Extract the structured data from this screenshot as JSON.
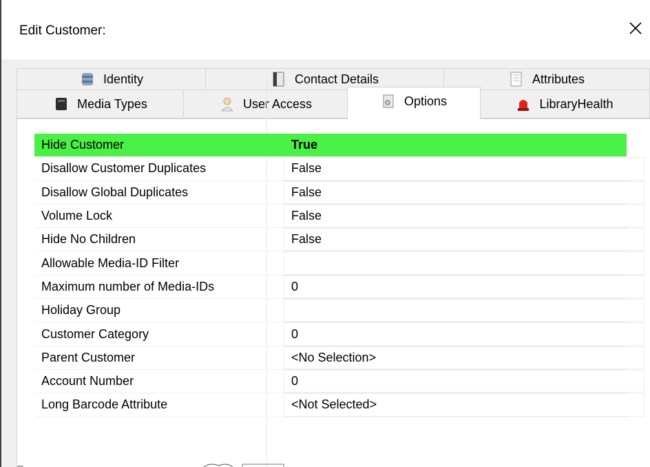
{
  "window": {
    "title": "Edit Customer:",
    "close_glyph": "✕"
  },
  "tabs_row1": [
    {
      "label": "Identity",
      "icon": "identity-icon"
    },
    {
      "label": "Contact Details",
      "icon": "contact-details-icon"
    },
    {
      "label": "Attributes",
      "icon": "attributes-icon"
    }
  ],
  "tabs_row2": [
    {
      "label": "Media Types",
      "icon": "media-types-icon"
    },
    {
      "label": "User Access",
      "icon": "user-access-icon"
    },
    {
      "label": "Options",
      "icon": "options-icon",
      "active": true
    },
    {
      "label": "LibraryHealth",
      "icon": "library-health-icon"
    }
  ],
  "properties": [
    {
      "name": "Hide Customer",
      "value": "True",
      "selected": true
    },
    {
      "name": "Disallow Customer Duplicates",
      "value": "False"
    },
    {
      "name": "Disallow Global Duplicates",
      "value": "False"
    },
    {
      "name": "Volume Lock",
      "value": "False"
    },
    {
      "name": "Hide No Children",
      "value": "False"
    },
    {
      "name": "Allowable Media-ID Filter",
      "value": ""
    },
    {
      "name": "Maximum number of Media-IDs",
      "value": "0"
    },
    {
      "name": "Holiday Group",
      "value": ""
    },
    {
      "name": "Customer Category",
      "value": "0"
    },
    {
      "name": "Parent Customer",
      "value": "<No Selection>"
    },
    {
      "name": "Account Number",
      "value": "0"
    },
    {
      "name": "Long Barcode Attribute",
      "value": "<Not Selected>"
    }
  ],
  "colors": {
    "selected_row": "#4af046",
    "client_bg": "#f0f0f0"
  }
}
